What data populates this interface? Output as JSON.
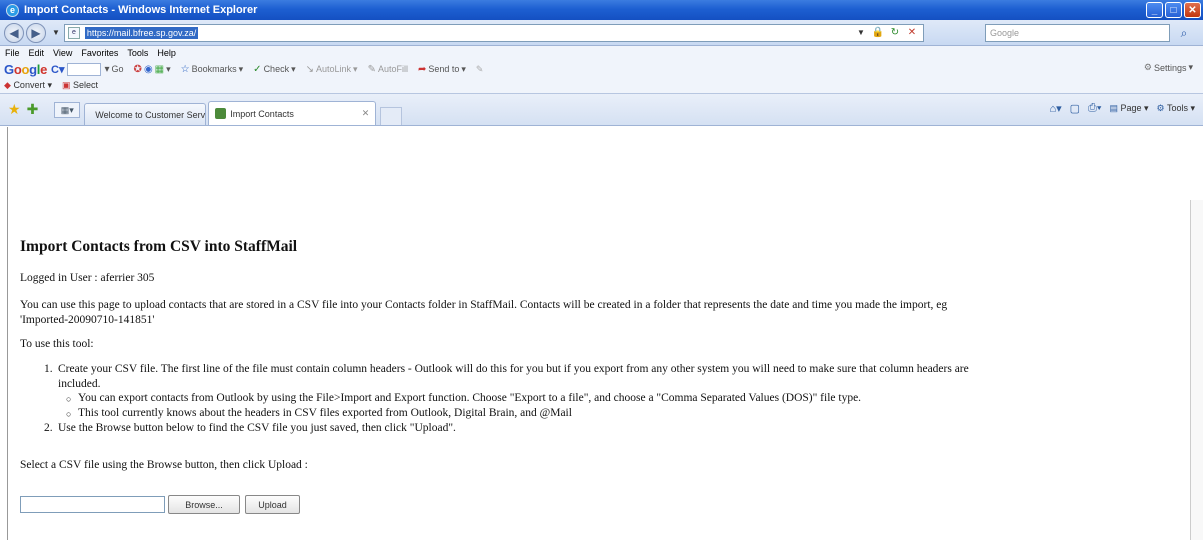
{
  "window": {
    "title": "Import Contacts - Windows Internet Explorer",
    "buttons": [
      "_",
      "□",
      "✕"
    ]
  },
  "address": {
    "url": "https://mail.bfree.sp.gov.za/",
    "search_placeholder": "Google"
  },
  "menu": [
    "File",
    "Edit",
    "View",
    "Favorites",
    "Tools",
    "Help"
  ],
  "google_toolbar": {
    "logo": "Google",
    "items": [
      "Go",
      "Bookmarks",
      "Check",
      "AutoLink",
      "AutoFill",
      "Send to"
    ],
    "settings": "Settings"
  },
  "convert_bar": {
    "convert": "Convert",
    "select": "Select"
  },
  "tabs": [
    {
      "label": "Welcome to Customer Service C..."
    },
    {
      "label": "Import Contacts"
    }
  ],
  "command_bar": {
    "page": "Page",
    "tools": "Tools"
  },
  "page": {
    "heading": "Import Contacts from CSV into StaffMail",
    "logged_in": "Logged in User : aferrier 305",
    "intro_line1": "You can use this page to upload contacts that are stored in a CSV file into your Contacts folder in StaffMail. Contacts will be created in a folder that represents the date and time you made the import, eg",
    "intro_line2": "'Imported-20090710-141851'",
    "use_tool": "To use this tool:",
    "step1_num": "1.",
    "step1_line1": "Create your CSV file. The first line of the file must contain column headers - Outlook will do this for you but if you export from any other system you will need to make sure that column headers are",
    "step1_line2": "included.",
    "sub1": "You can export contacts from Outlook by using the File>Import and Export function. Choose \"Export to a file\", and choose a \"Comma Separated Values (DOS)\" file type.",
    "sub2": "This tool currently knows about the headers in CSV files exported from Outlook, Digital Brain, and @Mail",
    "step2_num": "2.",
    "step2": "Use the Browse button below to find the CSV file you just saved, then click \"Upload\".",
    "select_prompt": "Select a CSV file using the Browse button, then click Upload :",
    "browse_label": "Browse...",
    "upload_label": "Upload"
  }
}
